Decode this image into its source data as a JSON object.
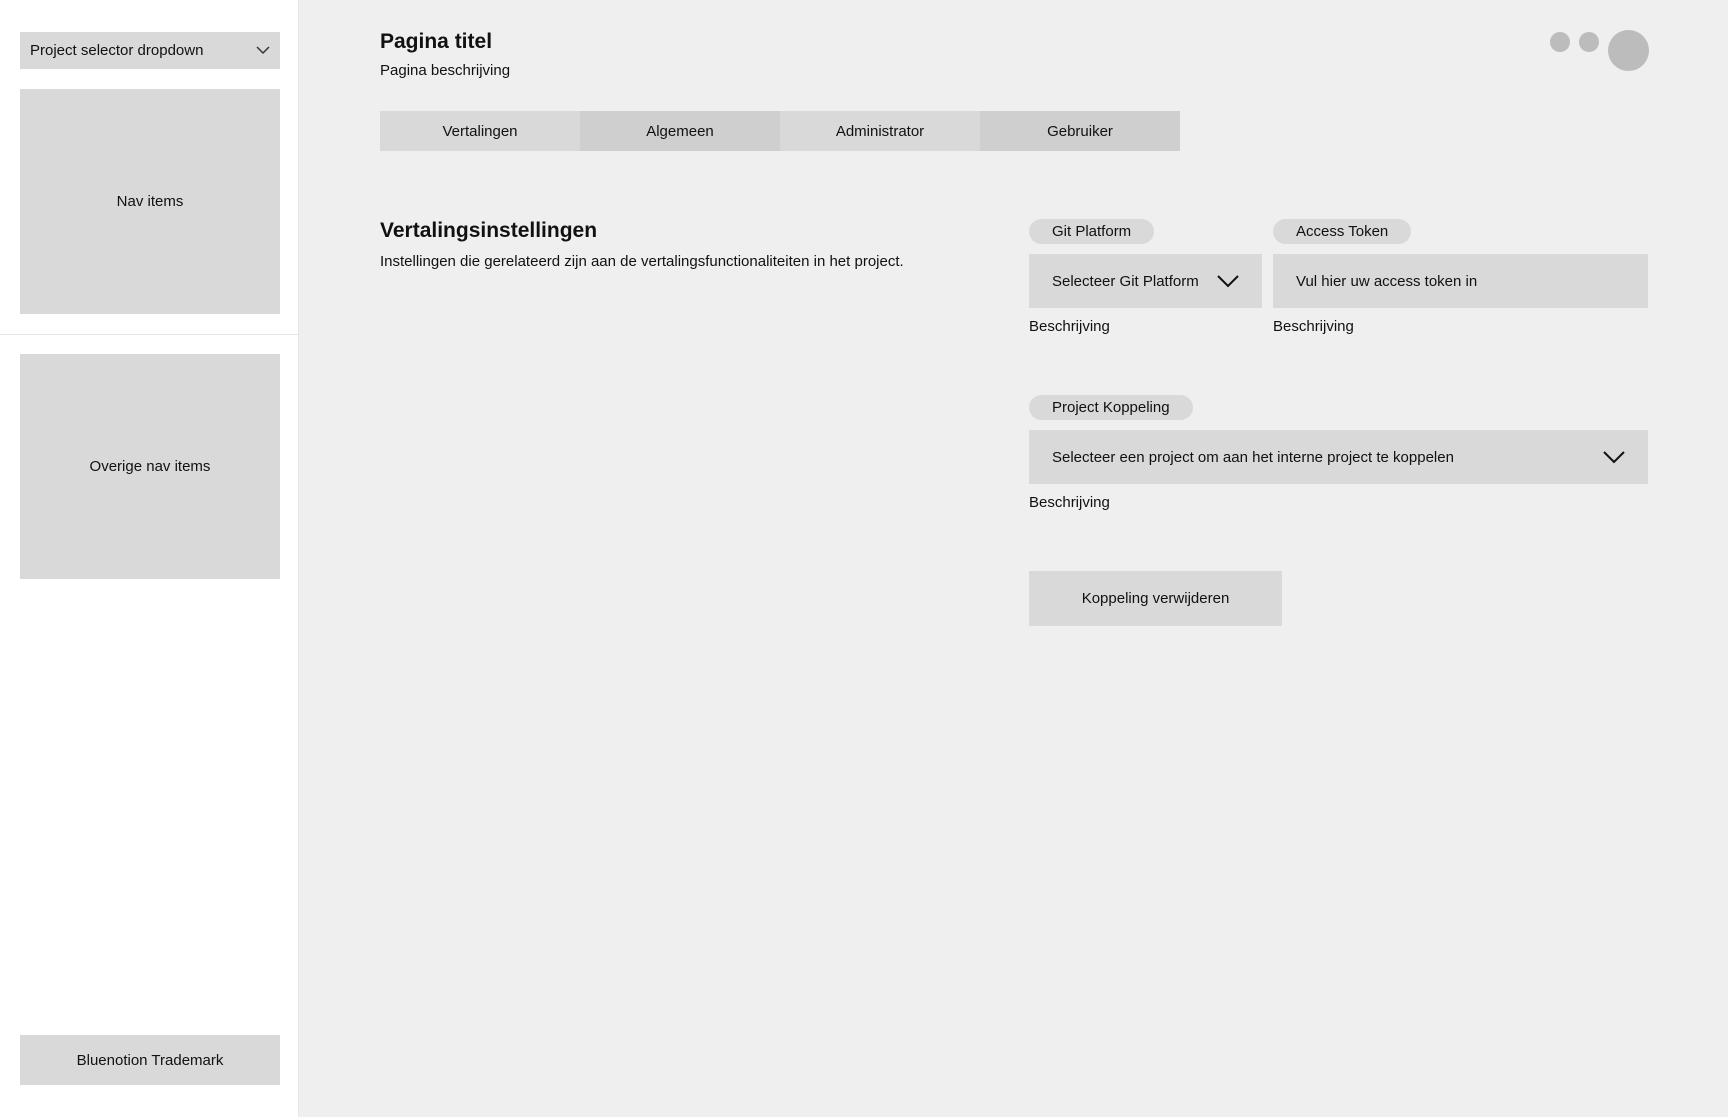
{
  "sidebar": {
    "project_selector": "Project selector dropdown",
    "nav_items": "Nav items",
    "other_nav_items": "Overige nav items",
    "trademark": "Bluenotion Trademark"
  },
  "header": {
    "title": "Pagina titel",
    "description": "Pagina beschrijving"
  },
  "tabs": [
    {
      "label": "Vertalingen"
    },
    {
      "label": "Algemeen"
    },
    {
      "label": "Administrator"
    },
    {
      "label": "Gebruiker"
    }
  ],
  "section": {
    "title": "Vertalingsinstellingen",
    "description": "Instellingen die gerelateerd zijn aan de vertalingsfunctionaliteiten in het project."
  },
  "fields": {
    "git_platform": {
      "label": "Git Platform",
      "value": "Selecteer Git Platform",
      "description": "Beschrijving"
    },
    "access_token": {
      "label": "Access Token",
      "placeholder": "Vul hier uw access token in",
      "description": "Beschrijving"
    },
    "project_koppeling": {
      "label": "Project Koppeling",
      "value": "Selecteer een project om aan het interne project te koppelen",
      "description": "Beschrijving"
    }
  },
  "actions": {
    "remove_link": "Koppeling verwijderen"
  },
  "icons": {
    "dropdown": "chevron-down-icon"
  },
  "colors": {
    "sidebar_bg": "#ffffff",
    "main_bg": "#efefef",
    "placeholder_block": "#d9d9d9"
  }
}
